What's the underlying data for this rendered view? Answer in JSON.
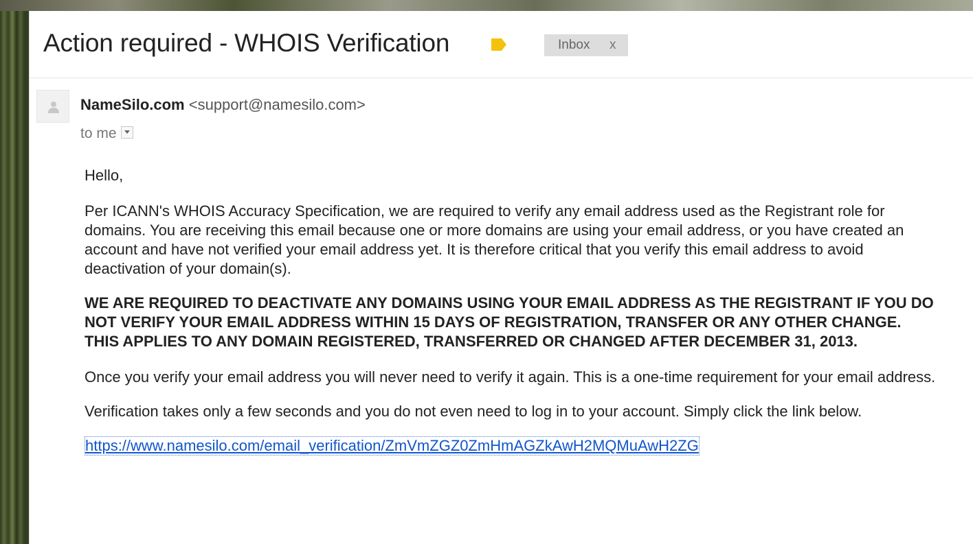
{
  "email": {
    "subject": "Action required - WHOIS Verification",
    "label_icon": "label-tag-icon",
    "label_color": "#f4c20d",
    "inbox_chip": {
      "label": "Inbox",
      "remove": "x"
    },
    "sender": {
      "name": "NameSilo.com",
      "email": "<support@namesilo.com>",
      "avatar_icon": "default-avatar-icon"
    },
    "recipient_line": "to me",
    "body": {
      "greeting": "Hello,",
      "paragraph1": "Per ICANN's WHOIS Accuracy Specification, we are required to verify any email address used as the Registrant role for domains. You are receiving this email because one or more domains are using your email address, or you have created an account and have not verified your email address yet. It is therefore critical that you verify this email address to avoid deactivation of your domain(s).",
      "notice": "WE ARE REQUIRED TO DEACTIVATE ANY DOMAINS USING YOUR EMAIL ADDRESS AS THE REGISTRANT IF YOU DO NOT VERIFY YOUR EMAIL ADDRESS WITHIN 15 DAYS OF REGISTRATION, TRANSFER OR ANY OTHER CHANGE. THIS APPLIES TO ANY DOMAIN REGISTERED, TRANSFERRED OR CHANGED AFTER DECEMBER 31, 2013.",
      "paragraph2": "Once you verify your email address you will never need to verify it again. This is a one-time requirement for your email address.",
      "paragraph3": "Verification takes only a few seconds and you do not even need to log in to your account. Simply click the link below.",
      "link_text": "https://www.namesilo.com/email_verification/ZmVmZGZ0ZmHmAGZkAwH2MQMuAwH2ZG"
    }
  },
  "colors": {
    "link": "#1155cc",
    "chip_background": "#dddddd"
  }
}
